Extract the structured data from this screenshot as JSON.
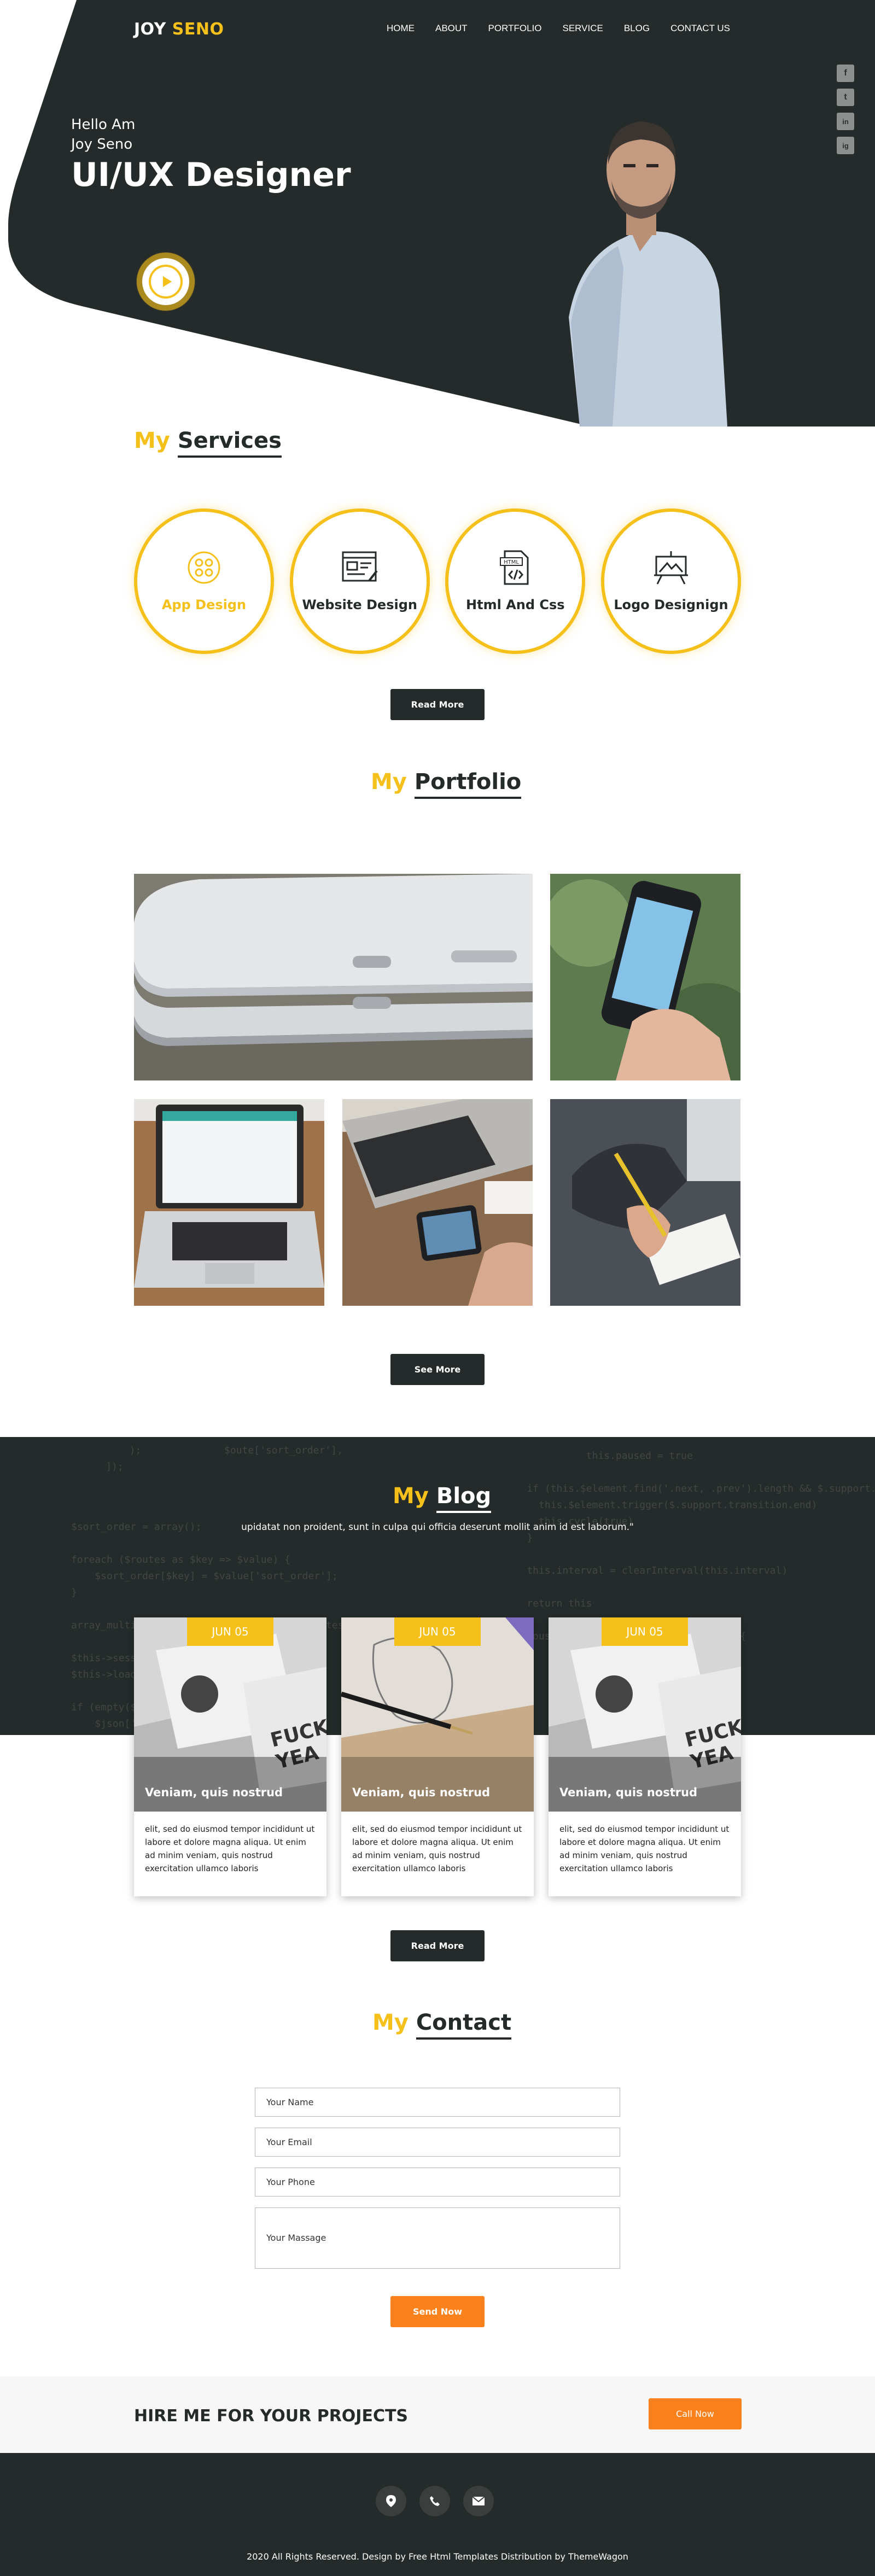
{
  "brand": {
    "first": "JOY",
    "second": "SENO"
  },
  "nav": [
    "HOME",
    "ABOUT",
    "PORTFOLIO",
    "SERVICE",
    "BLOG",
    "CONTACT US"
  ],
  "social": [
    "f",
    "t",
    "in",
    "ig"
  ],
  "hero": {
    "line1": "Hello Am",
    "line2": "Joy Seno",
    "title": "UI/UX Designer"
  },
  "services": {
    "heading_my": "My",
    "heading_word": "Services",
    "items": [
      "App Design",
      "Website Design",
      "Html And Css",
      "Logo Designign"
    ],
    "button": "Read More"
  },
  "portfolio": {
    "heading_my": "My",
    "heading_word": "Portfolio",
    "button": "See More"
  },
  "blog": {
    "heading_my": "My",
    "heading_word": "Blog",
    "subtitle": "upidatat non proident, sunt in culpa qui officia deserunt mollit anim id est laborum.\"",
    "cards": [
      {
        "date": "JUN 05",
        "title": "Veniam, quis nostrud",
        "text": "elit, sed do eiusmod tempor incididunt ut labore et dolore magna aliqua. Ut enim ad minim veniam, quis nostrud exercitation ullamco laboris"
      },
      {
        "date": "JUN 05",
        "title": "Veniam, quis nostrud",
        "text": "elit, sed do eiusmod tempor incididunt ut labore et dolore magna aliqua. Ut enim ad minim veniam, quis nostrud exercitation ullamco laboris"
      },
      {
        "date": "JUN 05",
        "title": "Veniam, quis nostrud",
        "text": "elit, sed do eiusmod tempor incididunt ut labore et dolore magna aliqua. Ut enim ad minim veniam, quis nostrud exercitation ullamco laboris"
      }
    ],
    "button": "Read More"
  },
  "contact": {
    "heading_my": "My",
    "heading_word": "Contact",
    "name_placeholder": "Your Name",
    "email_placeholder": "Your Email",
    "phone_placeholder": "Your Phone",
    "message_placeholder": "Your Massage",
    "button": "Send Now"
  },
  "hire": {
    "text": "HIRE ME FOR YOUR PROJECTS",
    "button": "Call Now"
  },
  "footer": {
    "icons": [
      "map-pin-icon",
      "phone-icon",
      "mail-icon"
    ],
    "copyright": "2020 All Rights Reserved. Design by Free Html Templates Distribution by ThemeWagon"
  },
  "colors": {
    "accent": "#f5c01a",
    "dark": "#252b2a",
    "orange": "#fa811c"
  }
}
